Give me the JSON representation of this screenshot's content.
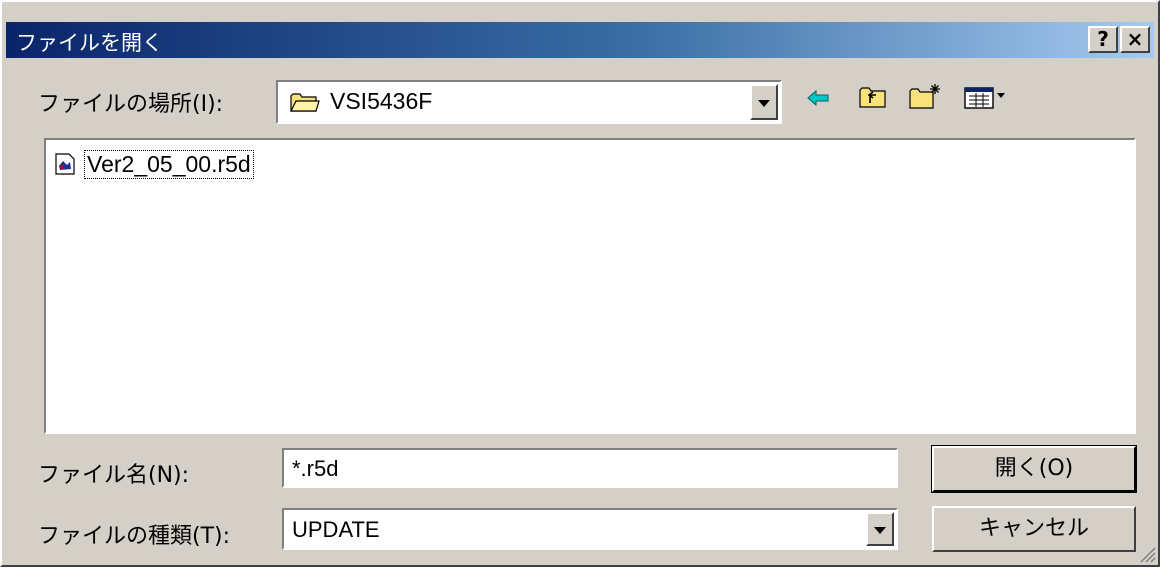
{
  "titlebar": {
    "title": "ファイルを開く",
    "help": "?",
    "close": "×"
  },
  "location": {
    "label": "ファイルの場所(I):",
    "value": "VSI5436F"
  },
  "toolbar": {
    "back": "back-arrow-icon",
    "up": "up-folder-icon",
    "new_folder": "new-folder-icon",
    "view": "view-menu-icon"
  },
  "files": [
    {
      "name": "Ver2_05_00.r5d",
      "icon": "r5d-file-icon"
    }
  ],
  "filename": {
    "label": "ファイル名(N):",
    "value": "*.r5d"
  },
  "filetype": {
    "label": "ファイルの種類(T):",
    "value": "UPDATE"
  },
  "buttons": {
    "open": "開く(O)",
    "cancel": "キャンセル"
  },
  "colors": {
    "title_start": "#0a246a",
    "title_end": "#a6caf0",
    "face": "#d4d0c8",
    "field": "#ffffff"
  }
}
